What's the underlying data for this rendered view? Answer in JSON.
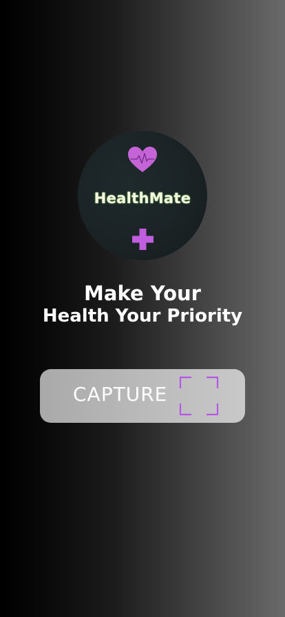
{
  "brand": {
    "name": "HealthMate",
    "logo_icon_top": "heart-pulse-icon",
    "logo_icon_bottom": "medical-cross-icon",
    "accent_color": "#c15ee0",
    "name_color": "#f4f6df",
    "circle_color": "#1a2224"
  },
  "headline": {
    "line1": "Make Your",
    "line2": "Health Your Priority"
  },
  "capture_button": {
    "label": "CAPTURE",
    "icon": "scan-frame-icon",
    "icon_color": "#b656e6"
  }
}
